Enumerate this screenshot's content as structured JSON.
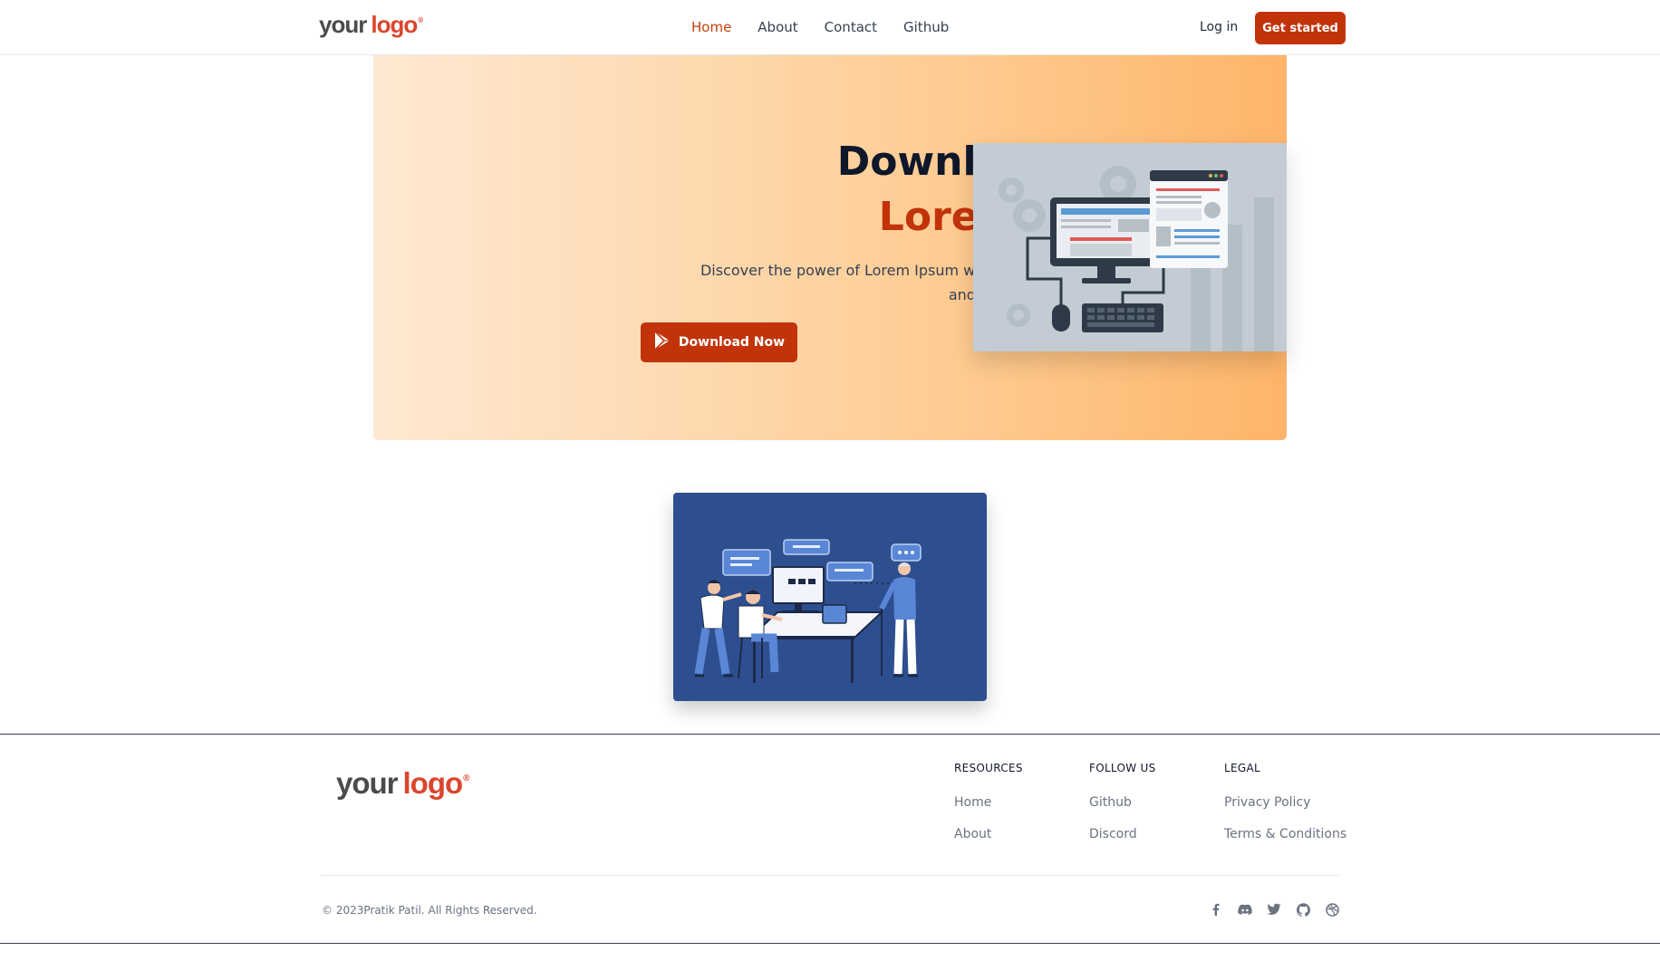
{
  "header": {
    "logo": {
      "part1": "your",
      "part2": "logo",
      "mark": "®"
    },
    "nav": [
      {
        "label": "Home",
        "active": true
      },
      {
        "label": "About",
        "active": false
      },
      {
        "label": "Contact",
        "active": false
      },
      {
        "label": "Github",
        "active": false
      }
    ],
    "login_label": "Log in",
    "cta_label": "Get started"
  },
  "hero": {
    "title_line1": "Download Now",
    "title_line2": "Lorem Ipsum",
    "description_line1": "Discover the power of Lorem Ipsum with a click. Get started now",
    "description_line2": "and enhance your experience!",
    "button_label": "Download Now",
    "button_icon": "play-store-icon"
  },
  "colors": {
    "accent": "#c2330a",
    "logo_accent": "#d9462c",
    "hero_gradient_start": "#fee9d2",
    "hero_gradient_end": "#feb46a",
    "illustration_bg": "#2e4f8f"
  },
  "footer": {
    "logo": {
      "part1": "your",
      "part2": "logo",
      "mark": "®"
    },
    "columns": [
      {
        "heading": "RESOURCES",
        "links": [
          "Home",
          "About"
        ]
      },
      {
        "heading": "FOLLOW US",
        "links": [
          "Github",
          "Discord"
        ]
      },
      {
        "heading": "LEGAL",
        "links": [
          "Privacy Policy",
          "Terms & Conditions"
        ]
      }
    ],
    "copyright": "© 2023Pratik Patil. All Rights Reserved.",
    "socials": [
      "facebook-icon",
      "discord-icon",
      "twitter-icon",
      "github-icon",
      "dribbble-icon"
    ]
  }
}
